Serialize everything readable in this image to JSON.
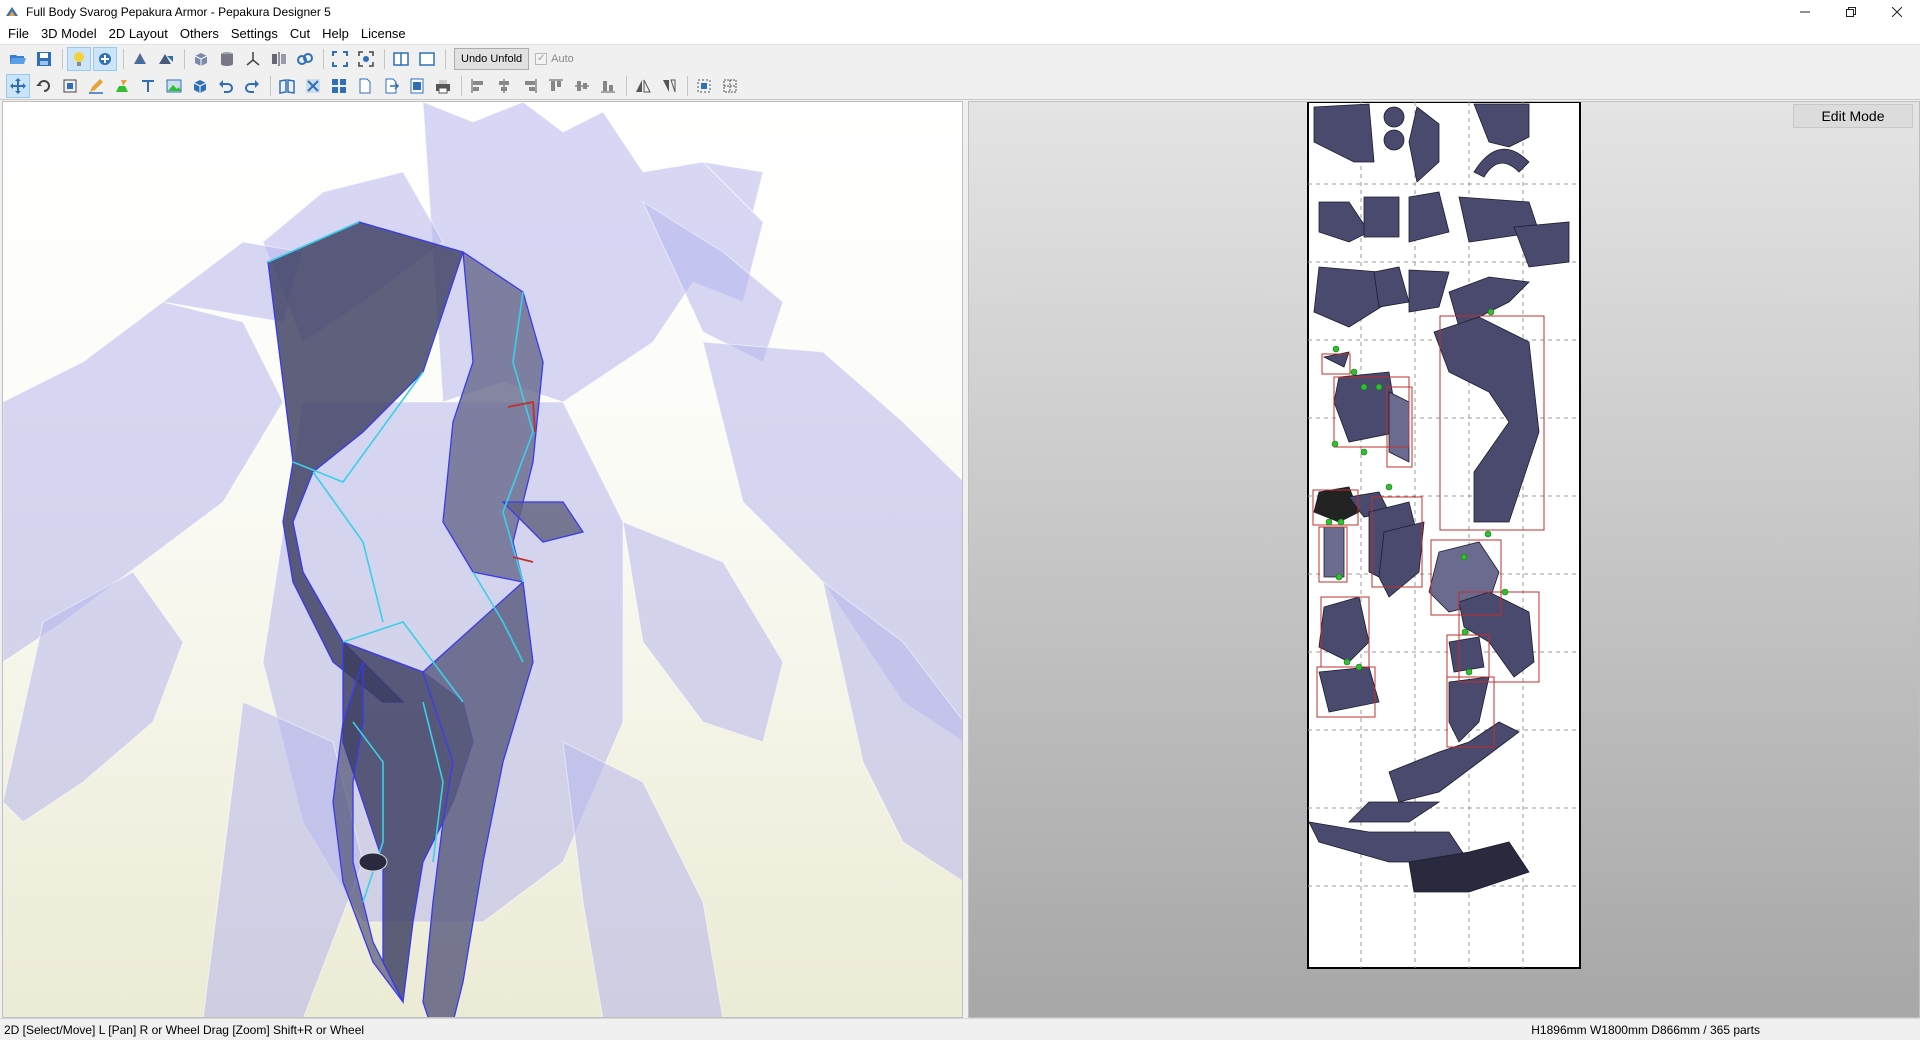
{
  "window": {
    "title": "Full Body Svarog Pepakura Armor - Pepakura Designer 5",
    "app_icon": "pepakura-icon",
    "controls": [
      "minimize-icon",
      "restore-icon",
      "close-icon"
    ]
  },
  "menu": [
    {
      "label": "File"
    },
    {
      "label": "3D Model"
    },
    {
      "label": "2D Layout"
    },
    {
      "label": "Others"
    },
    {
      "label": "Settings"
    },
    {
      "label": "Cut"
    },
    {
      "label": "Help"
    },
    {
      "label": "License"
    }
  ],
  "toolbar1": {
    "undo_unfold_label": "Undo Unfold",
    "auto_label": "Auto",
    "auto_checked": true
  },
  "view2d": {
    "mode_label": "Edit Mode"
  },
  "status": {
    "left": "2D [Select/Move] L [Pan] R or Wheel Drag [Zoom] Shift+R or Wheel",
    "right": "H1896mm W1800mm D866mm / 365 parts"
  },
  "colors": {
    "model_translucent": "#b7b6ec",
    "parts_fill": "#4a4a6e",
    "edge_cyan": "#3ad0e8",
    "edge_blue": "#3a3af0",
    "selection_red": "#c0302e",
    "flap_green": "#2ec02e"
  }
}
